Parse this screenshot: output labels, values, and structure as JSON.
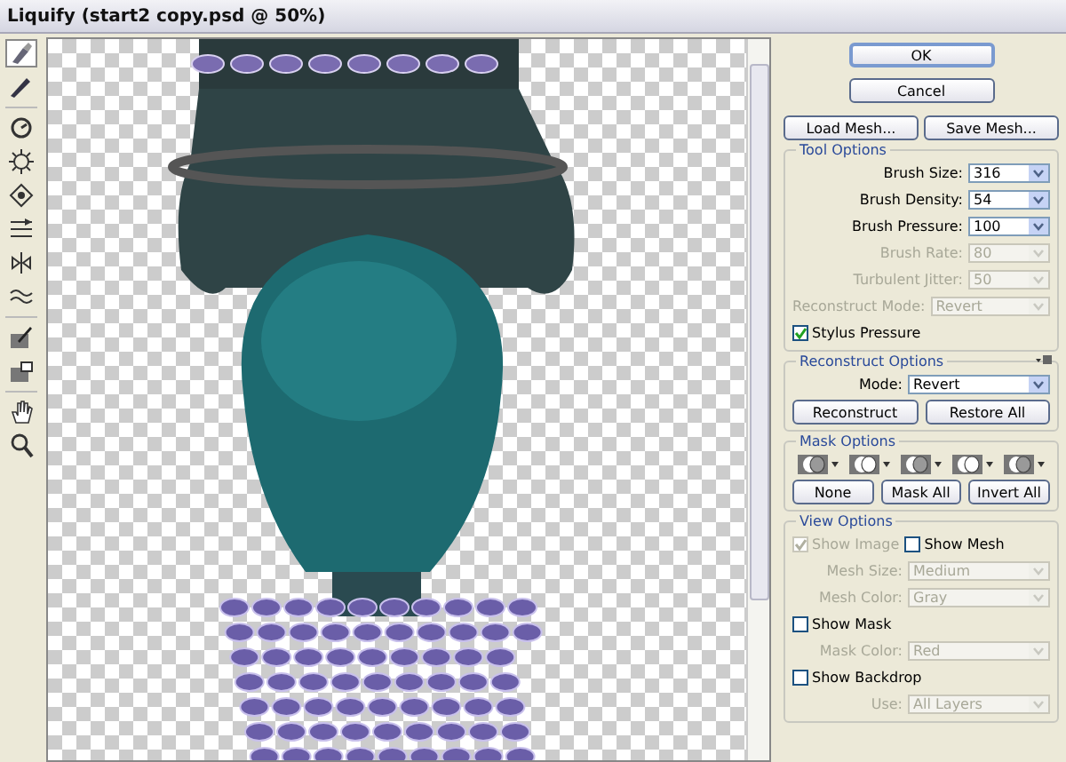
{
  "window": {
    "title": "Liquify (start2 copy.psd @ 50%)"
  },
  "tools": [
    {
      "selected": true
    },
    {
      "selected": false
    },
    {
      "selected": false
    },
    {
      "selected": false
    },
    {
      "selected": false
    },
    {
      "selected": false
    },
    {
      "selected": false
    },
    {
      "selected": false
    },
    {
      "selected": false
    },
    {
      "selected": false
    },
    {
      "selected": false
    },
    {
      "selected": false
    }
  ],
  "dialog_buttons": [
    {
      "label": "OK",
      "default": true
    },
    {
      "label": "Cancel",
      "default": false
    }
  ],
  "mesh_buttons": [
    "Load Mesh...",
    "Save Mesh..."
  ],
  "tool_options": {
    "title": "Tool Options",
    "rows": [
      {
        "kind": "select",
        "label": "Brush Size:",
        "value": "316",
        "disabled": false,
        "wide": false
      },
      {
        "kind": "select",
        "label": "Brush Density:",
        "value": "54",
        "disabled": false,
        "wide": false
      },
      {
        "kind": "select",
        "label": "Brush Pressure:",
        "value": "100",
        "disabled": false,
        "wide": false
      },
      {
        "kind": "select",
        "label": "Brush Rate:",
        "value": "80",
        "disabled": true,
        "wide": false
      },
      {
        "kind": "select",
        "label": "Turbulent Jitter:",
        "value": "50",
        "disabled": true,
        "wide": false
      },
      {
        "kind": "select",
        "label": "Reconstruct Mode:",
        "value": "Revert",
        "disabled": true,
        "wide": true
      },
      {
        "kind": "checkbox",
        "label": "Stylus Pressure",
        "checked": true,
        "disabled": false
      }
    ]
  },
  "reconstruct_options": {
    "title": "Reconstruct Options",
    "rows": [
      {
        "kind": "select",
        "label": "Mode:",
        "value": "Revert",
        "disabled": false,
        "wide": true
      }
    ],
    "buttons": [
      "Reconstruct",
      "Restore All"
    ]
  },
  "mask_options": {
    "title": "Mask Options",
    "buttons": [
      "None",
      "Mask All",
      "Invert All"
    ]
  },
  "view_options": {
    "title": "View Options",
    "rows": [
      {
        "kind": "checkpair",
        "items": [
          {
            "label": "Show Image",
            "checked": true,
            "disabled": true
          },
          {
            "label": "Show Mesh",
            "checked": false,
            "disabled": false
          }
        ]
      },
      {
        "kind": "select",
        "label": "Mesh Size:",
        "value": "Medium",
        "disabled": true,
        "wide": true
      },
      {
        "kind": "select",
        "label": "Mesh Color:",
        "value": "Gray",
        "disabled": true,
        "wide": true
      },
      {
        "kind": "checkbox",
        "label": "Show Mask",
        "checked": false,
        "disabled": false
      },
      {
        "kind": "select",
        "label": "Mask Color:",
        "value": "Red",
        "disabled": true,
        "wide": true
      },
      {
        "kind": "checkbox",
        "label": "Show Backdrop",
        "checked": false,
        "disabled": false
      },
      {
        "kind": "select",
        "label": "Use:",
        "value": "All Layers",
        "disabled": true,
        "wide": true
      }
    ]
  }
}
